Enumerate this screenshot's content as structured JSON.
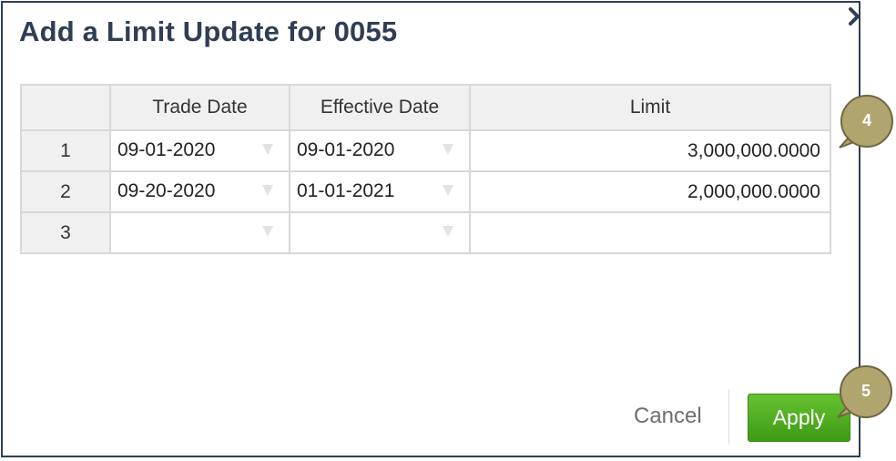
{
  "dialog": {
    "title": "Add a Limit Update for 0055",
    "close_icon": "close-chevron-icon"
  },
  "table": {
    "headers": [
      "",
      "Trade Date",
      "Effective Date",
      "Limit"
    ],
    "rows": [
      {
        "num": "1",
        "trade_date": "09-01-2020",
        "effective_date": "09-01-2020",
        "limit": "3,000,000.0000"
      },
      {
        "num": "2",
        "trade_date": "09-20-2020",
        "effective_date": "01-01-2021",
        "limit": "2,000,000.0000"
      },
      {
        "num": "3",
        "trade_date": "",
        "effective_date": "",
        "limit": ""
      }
    ],
    "dropdown_icon": "dropdown-caret-icon"
  },
  "callouts": [
    {
      "label": "4"
    },
    {
      "label": "5"
    }
  ],
  "footer": {
    "cancel_label": "Cancel",
    "apply_label": "Apply"
  },
  "colors": {
    "title": "#2f3e55",
    "apply_button": "#4caf1f",
    "callout": "#b1a56f"
  }
}
